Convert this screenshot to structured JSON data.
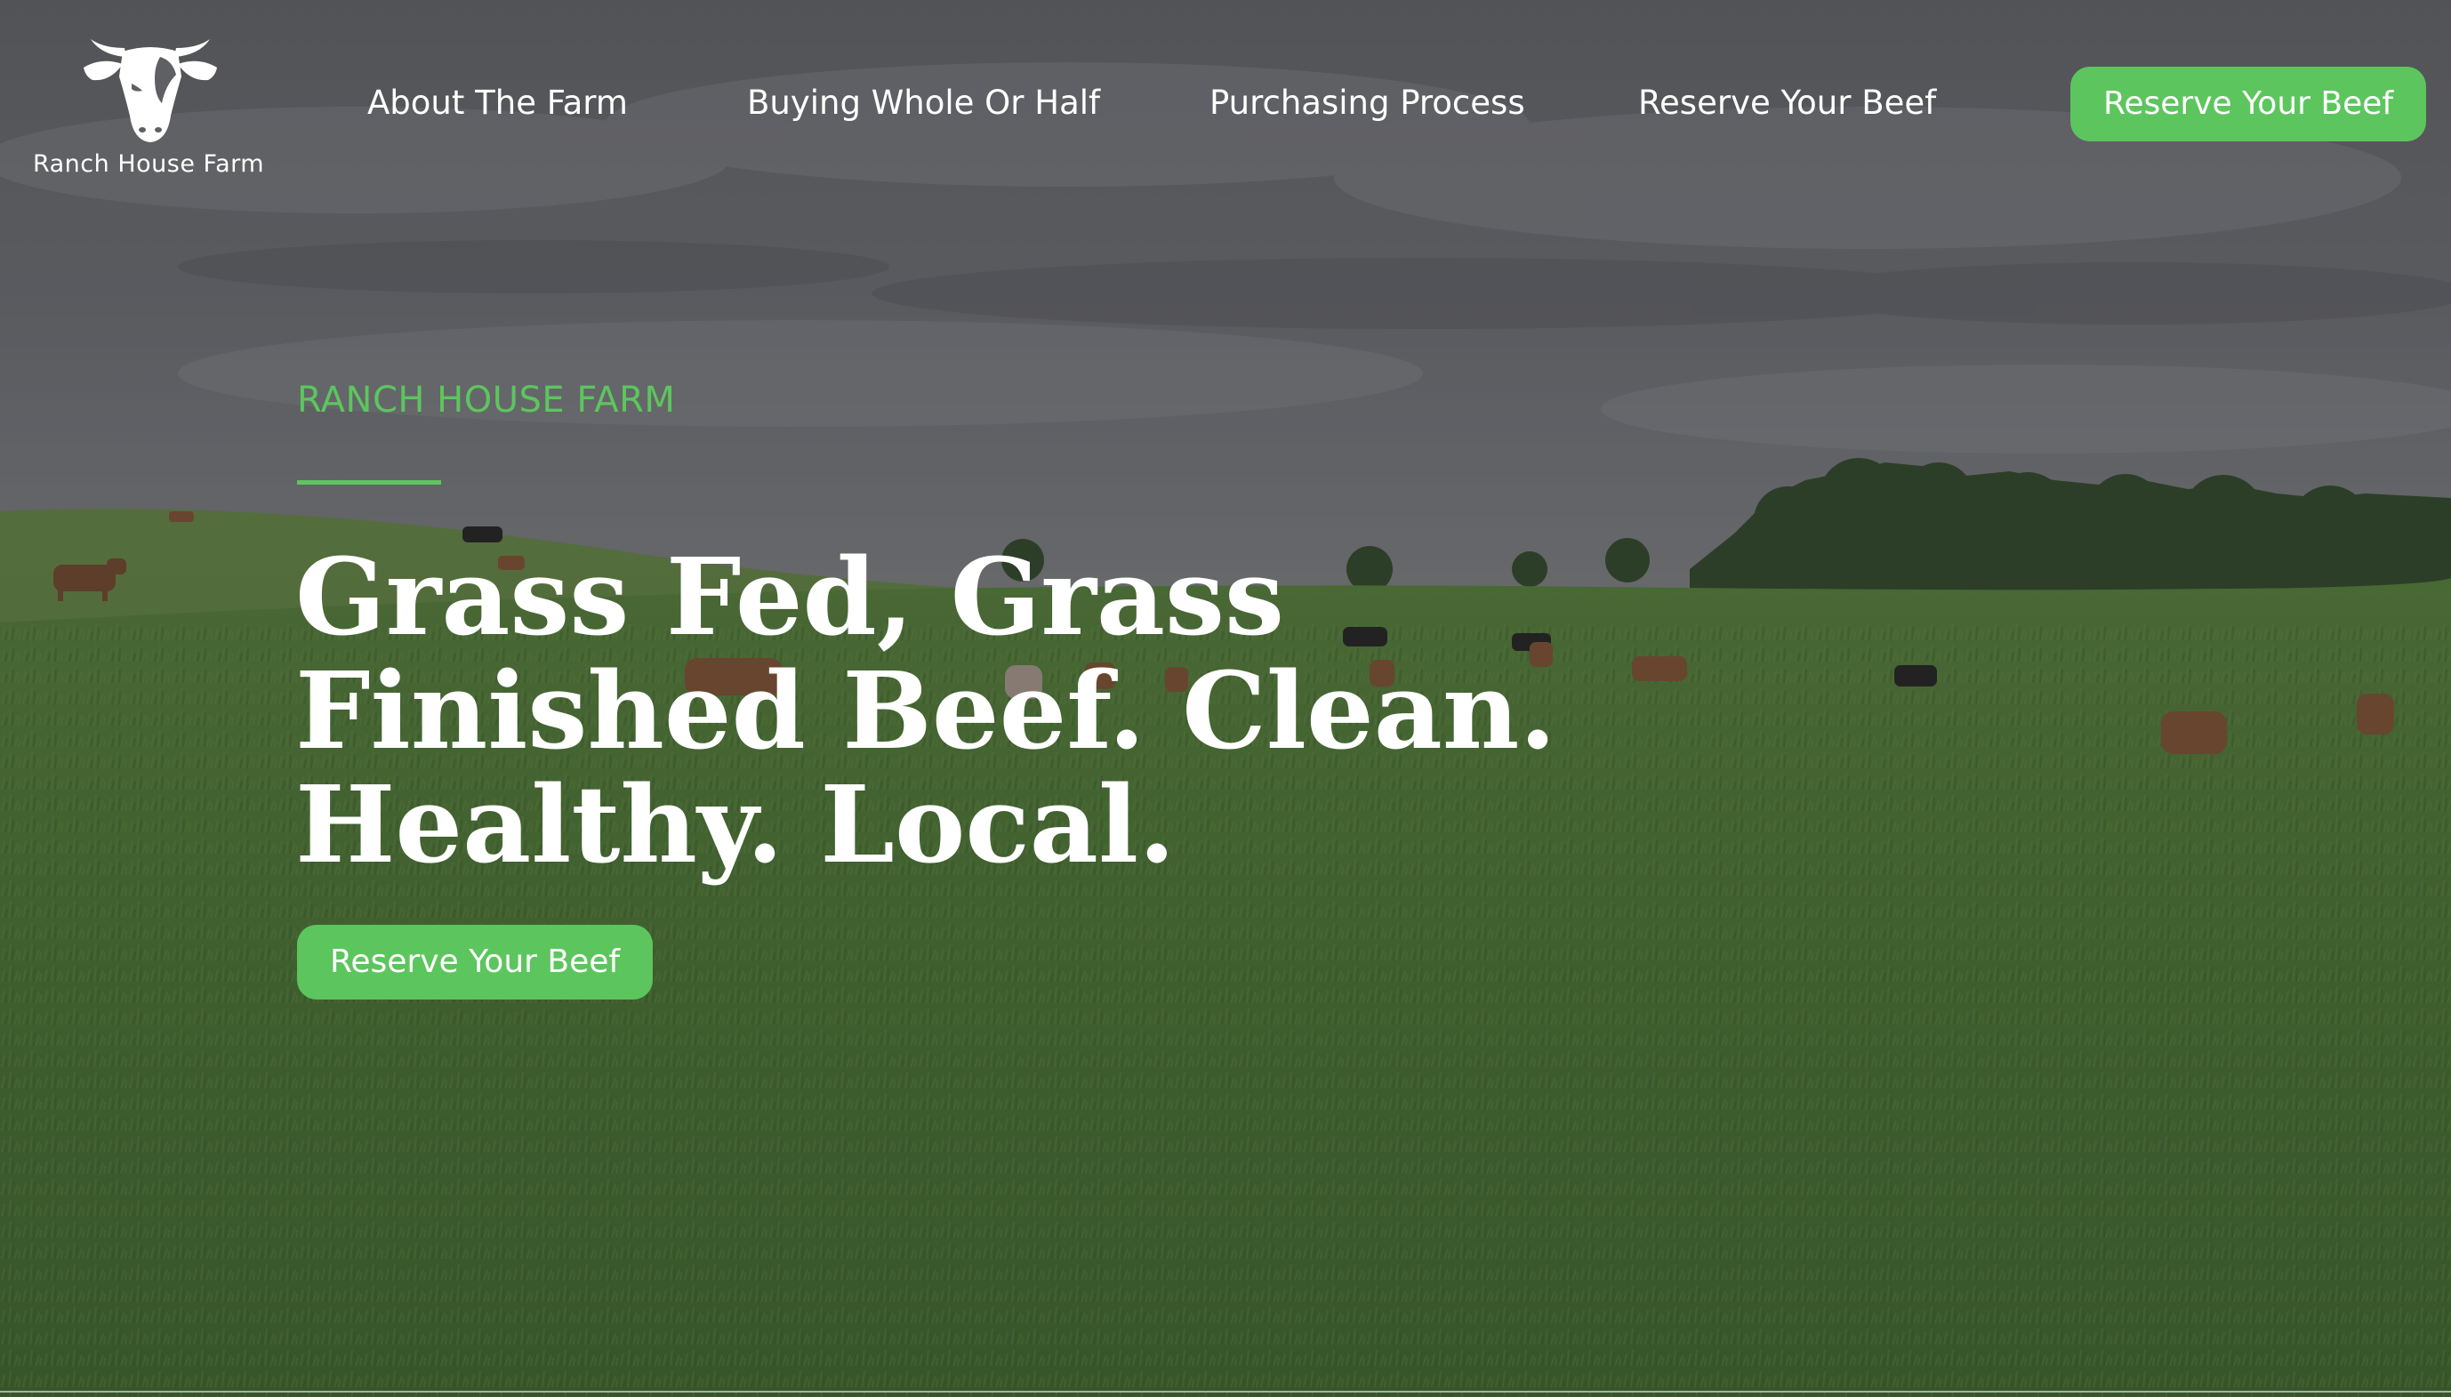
{
  "brand": {
    "name": "Ranch House Farm",
    "logo_icon": "cow-head-icon"
  },
  "nav": {
    "items": [
      {
        "label": "About The Farm"
      },
      {
        "label": "Buying Whole Or Half"
      },
      {
        "label": "Purchasing Process"
      },
      {
        "label": "Reserve Your Beef"
      }
    ],
    "cta_label": "Reserve Your Beef"
  },
  "hero": {
    "eyebrow": "RANCH HOUSE FARM",
    "title": "Grass Fed, Grass Finished Beef. Clean. Healthy. Local.",
    "cta_label": "Reserve Your Beef",
    "background": "pasture-with-grazing-cattle-image"
  },
  "colors": {
    "accent": "#5dc55e",
    "text": "#ffffff",
    "overlay": "#28282c",
    "sky": "#6b6c70",
    "grass": "#4f7d36"
  }
}
